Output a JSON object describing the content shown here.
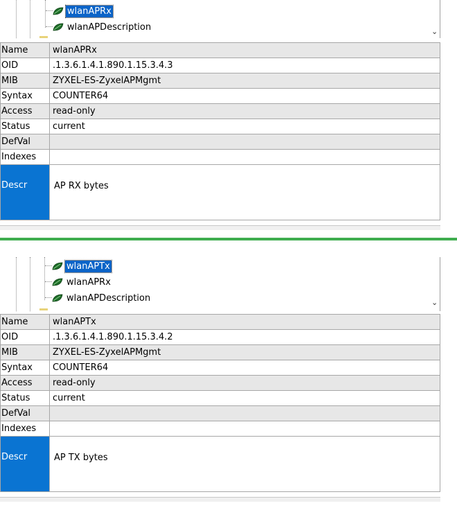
{
  "panel_a": {
    "tree": [
      {
        "label": "wlanAPRx",
        "selected": true
      },
      {
        "label": "wlanAPDescription",
        "selected": false
      }
    ],
    "rows": [
      {
        "key": "Name",
        "value": "wlanAPRx"
      },
      {
        "key": "OID",
        "value": ".1.3.6.1.4.1.890.1.15.3.4.3"
      },
      {
        "key": "MIB",
        "value": "ZYXEL-ES-ZyxelAPMgmt"
      },
      {
        "key": "Syntax",
        "value": "COUNTER64"
      },
      {
        "key": "Access",
        "value": "read-only"
      },
      {
        "key": "Status",
        "value": "current"
      },
      {
        "key": "DefVal",
        "value": ""
      },
      {
        "key": "Indexes",
        "value": ""
      },
      {
        "key": "Descr",
        "value": "AP RX bytes"
      }
    ]
  },
  "panel_b": {
    "tree": [
      {
        "label": "wlanAPTx",
        "selected": true
      },
      {
        "label": "wlanAPRx",
        "selected": false
      },
      {
        "label": "wlanAPDescription",
        "selected": false
      }
    ],
    "rows": [
      {
        "key": "Name",
        "value": "wlanAPTx"
      },
      {
        "key": "OID",
        "value": ".1.3.6.1.4.1.890.1.15.3.4.2"
      },
      {
        "key": "MIB",
        "value": "ZYXEL-ES-ZyxelAPMgmt"
      },
      {
        "key": "Syntax",
        "value": "COUNTER64"
      },
      {
        "key": "Access",
        "value": "read-only"
      },
      {
        "key": "Status",
        "value": "current"
      },
      {
        "key": "DefVal",
        "value": ""
      },
      {
        "key": "Indexes",
        "value": ""
      },
      {
        "key": "Descr",
        "value": "AP TX bytes"
      }
    ]
  },
  "icons": {
    "tree_leaf": "leaf-icon",
    "scroll_down": "chevron-down-icon"
  },
  "colors": {
    "selection": "#0a64c8",
    "descr_key": "#0a74d2",
    "separator": "#3fad4f",
    "leaf": "#1f6e2a"
  }
}
